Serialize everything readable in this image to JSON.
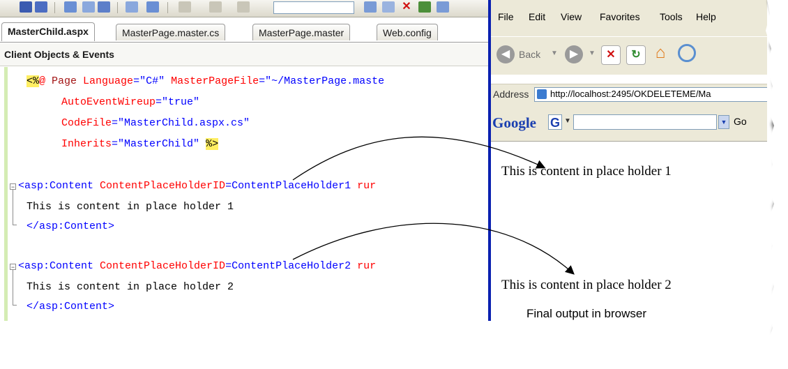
{
  "editor": {
    "tabs": [
      "MasterChild.aspx",
      "MasterPage.master.cs",
      "MasterPage.master",
      "Web.config"
    ],
    "object_bar_label": "Client Objects & Events",
    "code": {
      "line1_open": "<%",
      "line1_at": "@",
      "line1_page": " Page",
      "line1_attr1": " Language",
      "line1_eq1": "=",
      "line1_val1": "\"C#\"",
      "line1_attr2": " MasterPageFile",
      "line1_eq2": "=",
      "line1_val2": "\"~/MasterPage.maste",
      "line2_attr": "AutoEventWireup",
      "line2_eq": "=",
      "line2_val": "\"true\"",
      "line3_attr": "CodeFile",
      "line3_eq": "=",
      "line3_val": "\"MasterChild.aspx.cs\"",
      "line4_attr": "Inherits",
      "line4_eq": "=",
      "line4_val": "\"MasterChild\"",
      "line4_close": "%>",
      "block1_tag": "<asp:Content",
      "block1_attr": " ContentPlaceHolderID",
      "block1_eq": "=",
      "block1_val": "ContentPlaceHolder1",
      "block1_tail": " rur",
      "block1_text": "This is content in place holder 1",
      "block1_close": "</asp:Content>",
      "block2_tag": "<asp:Content",
      "block2_attr": " ContentPlaceHolderID",
      "block2_eq": "=",
      "block2_val": "ContentPlaceHolder2",
      "block2_tail": " rur",
      "block2_text": "This is content in place holder 2",
      "block2_close": "</asp:Content>"
    }
  },
  "browser": {
    "menu": [
      "File",
      "Edit",
      "View",
      "Favorites",
      "Tools",
      "Help"
    ],
    "back_label": "Back",
    "address_label": "Address",
    "address_url": "http://localhost:2495/OKDELETEME/Ma",
    "google_logo": "Google",
    "google_go": "Go",
    "content1": "This is content in place holder 1",
    "content2": "This is content in place holder 2"
  },
  "caption": "Final output in browser",
  "colors": {
    "separator": "#0a20b0",
    "code_red": "#ff0000",
    "code_blue": "#0000ff",
    "code_brown": "#a31515",
    "highlight": "#ffee62"
  }
}
